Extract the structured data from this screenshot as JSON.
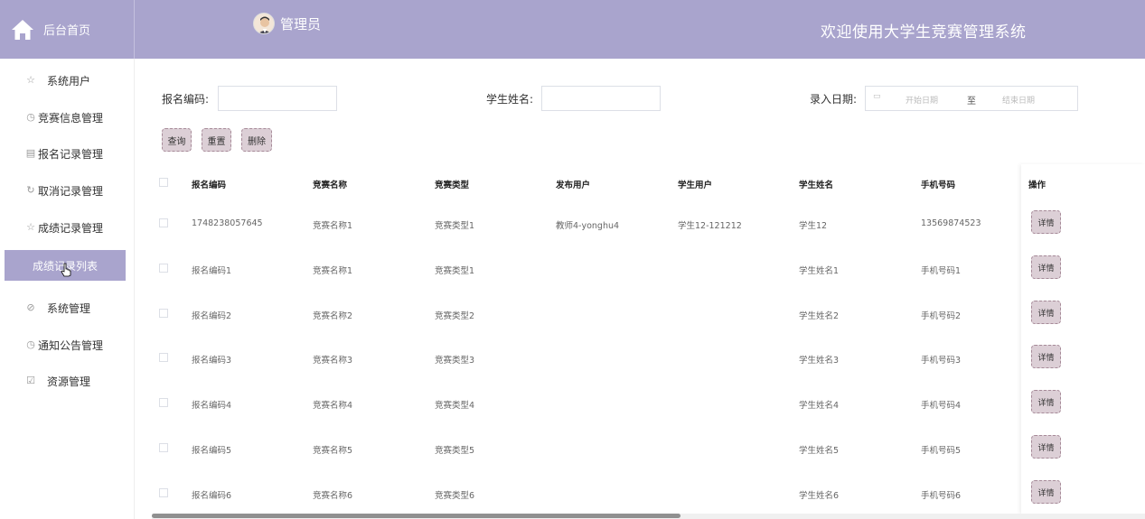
{
  "header": {
    "home_label": "后台首页",
    "admin_label": "管理员",
    "welcome": "欢迎使用大学生竞赛管理系统"
  },
  "sidebar": {
    "items": [
      {
        "label": "系统用户",
        "icon": "star-icon"
      },
      {
        "label": "竞赛信息管理",
        "icon": "clock-icon"
      },
      {
        "label": "报名记录管理",
        "icon": "store-icon"
      },
      {
        "label": "取消记录管理",
        "icon": "refresh-icon"
      },
      {
        "label": "成绩记录管理",
        "icon": "star-icon"
      },
      {
        "label": "成绩记录列表",
        "icon": ""
      },
      {
        "label": "系统管理",
        "icon": "compass-icon"
      },
      {
        "label": "通知公告管理",
        "icon": "clock-icon"
      },
      {
        "label": "资源管理",
        "icon": "calendar-check-icon"
      }
    ],
    "active_index": 5
  },
  "filters": {
    "code_label": "报名编码:",
    "code_value": "",
    "name_label": "学生姓名:",
    "name_value": "",
    "date_label": "录入日期:",
    "date_start_placeholder": "开始日期",
    "date_sep": "至",
    "date_end_placeholder": "结束日期"
  },
  "buttons": {
    "query": "查询",
    "reset": "重置",
    "delete": "删除"
  },
  "table": {
    "headers": [
      "报名编码",
      "竞赛名称",
      "竞赛类型",
      "发布用户",
      "学生用户",
      "学生姓名",
      "手机号码",
      "操作"
    ],
    "detail_label": "详情",
    "rows": [
      [
        "1748238057645",
        "竞赛名称1",
        "竞赛类型1",
        "教师4-yonghu4",
        "学生12-121212",
        "学生12",
        "13569874523"
      ],
      [
        "报名编码1",
        "竞赛名称1",
        "竞赛类型1",
        "",
        "",
        "学生姓名1",
        "手机号码1"
      ],
      [
        "报名编码2",
        "竞赛名称2",
        "竞赛类型2",
        "",
        "",
        "学生姓名2",
        "手机号码2"
      ],
      [
        "报名编码3",
        "竞赛名称3",
        "竞赛类型3",
        "",
        "",
        "学生姓名3",
        "手机号码3"
      ],
      [
        "报名编码4",
        "竞赛名称4",
        "竞赛类型4",
        "",
        "",
        "学生姓名4",
        "手机号码4"
      ],
      [
        "报名编码5",
        "竞赛名称5",
        "竞赛类型5",
        "",
        "",
        "学生姓名5",
        "手机号码5"
      ],
      [
        "报名编码6",
        "竞赛名称6",
        "竞赛类型6",
        "",
        "",
        "学生姓名6",
        "手机号码6"
      ]
    ]
  },
  "colors": {
    "accent": "#a9a4cd",
    "button_bg": "#dccfd6",
    "button_border": "#a68a98"
  }
}
